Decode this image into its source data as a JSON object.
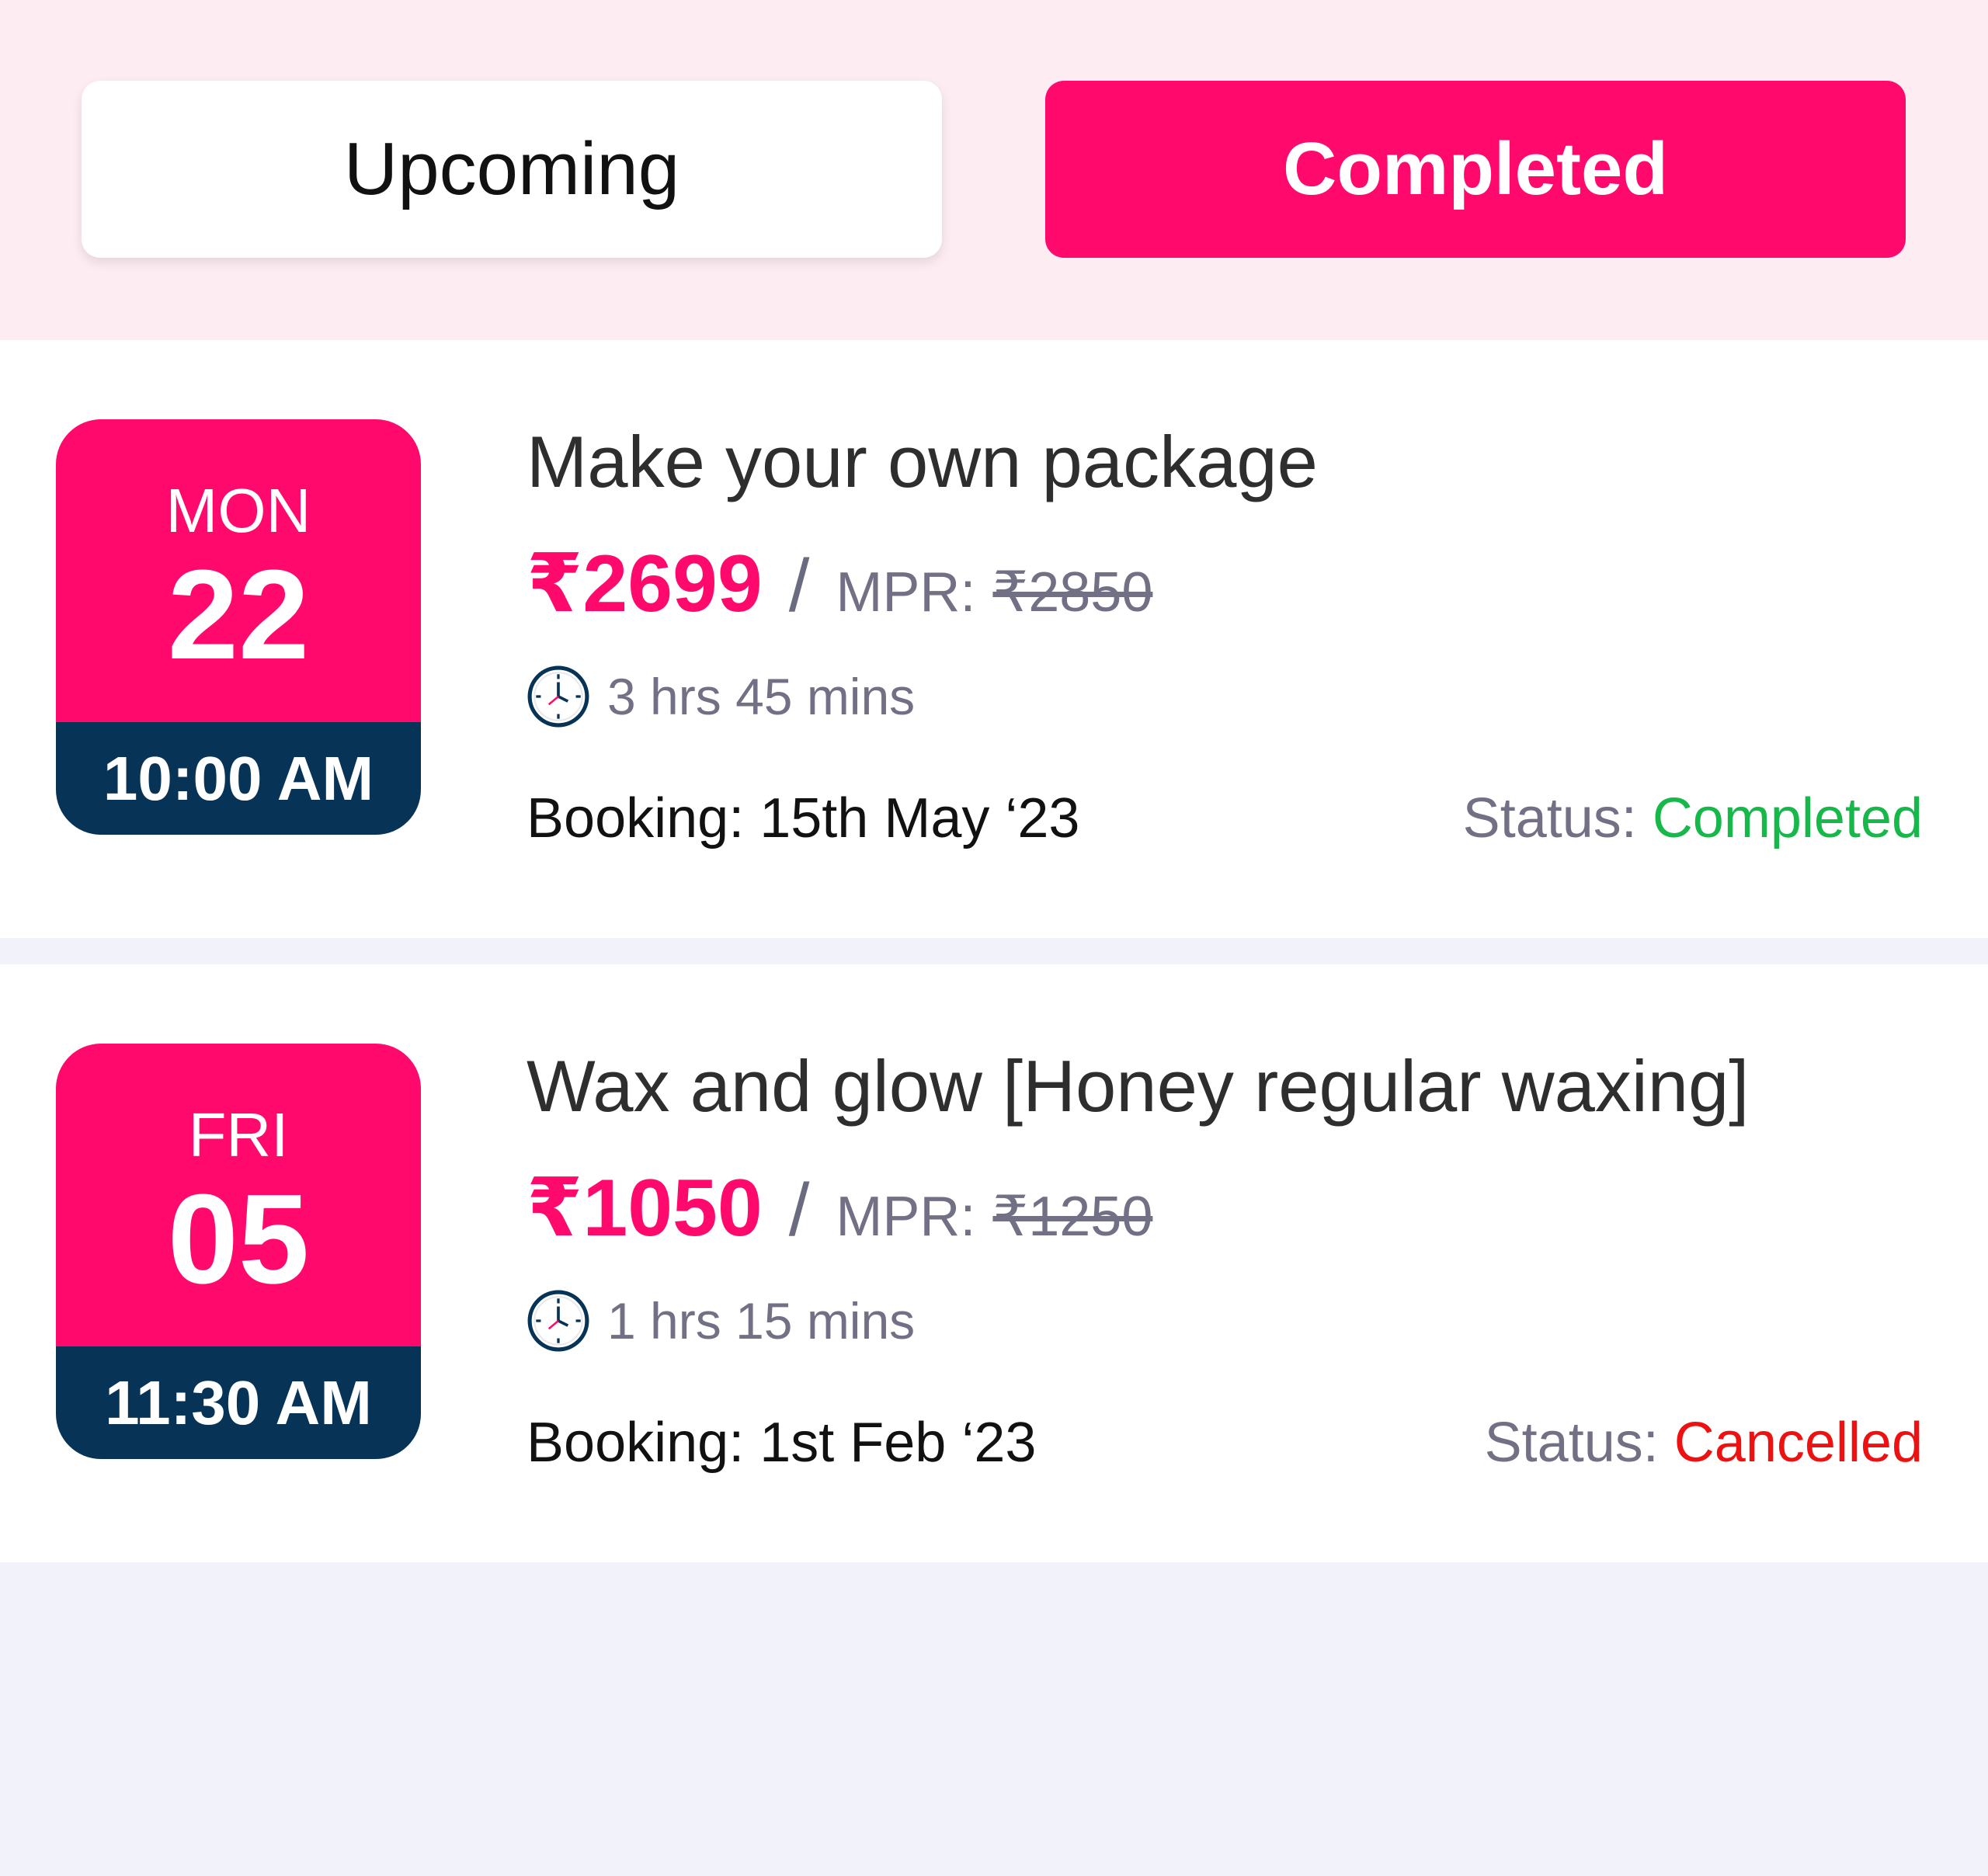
{
  "tabs": {
    "upcoming_label": "Upcoming",
    "completed_label": "Completed",
    "active": "Completed"
  },
  "bookings": [
    {
      "weekday": "MON",
      "day": "22",
      "time": "10:00 AM",
      "title": "Make your own package",
      "price": "₹2699",
      "separator": "/",
      "mpr_label": "MPR:",
      "mpr_value": "₹2850",
      "duration": "3 hrs 45 mins",
      "booking_text": "Booking: 15th May ‘23",
      "status_label": "Status:",
      "status_value": "Completed"
    },
    {
      "weekday": "FRI",
      "day": "05",
      "time": "11:30 AM",
      "title": "Wax and glow [Honey regular waxing]",
      "price": "₹1050",
      "separator": "/",
      "mpr_label": "MPR:",
      "mpr_value": "₹1250",
      "duration": "1 hrs 15 mins",
      "booking_text": "Booking: 1st Feb ‘23",
      "status_label": "Status:",
      "status_value": "Cancelled"
    }
  ],
  "icons": {
    "duration": "clock-icon"
  },
  "colors": {
    "accent": "#ff0a6c",
    "time_badge": "#063356",
    "status_completed": "#16b84a",
    "status_cancelled": "#ee1111",
    "tabs_background": "#fdedf3",
    "page_background": "#f1f2fa"
  }
}
